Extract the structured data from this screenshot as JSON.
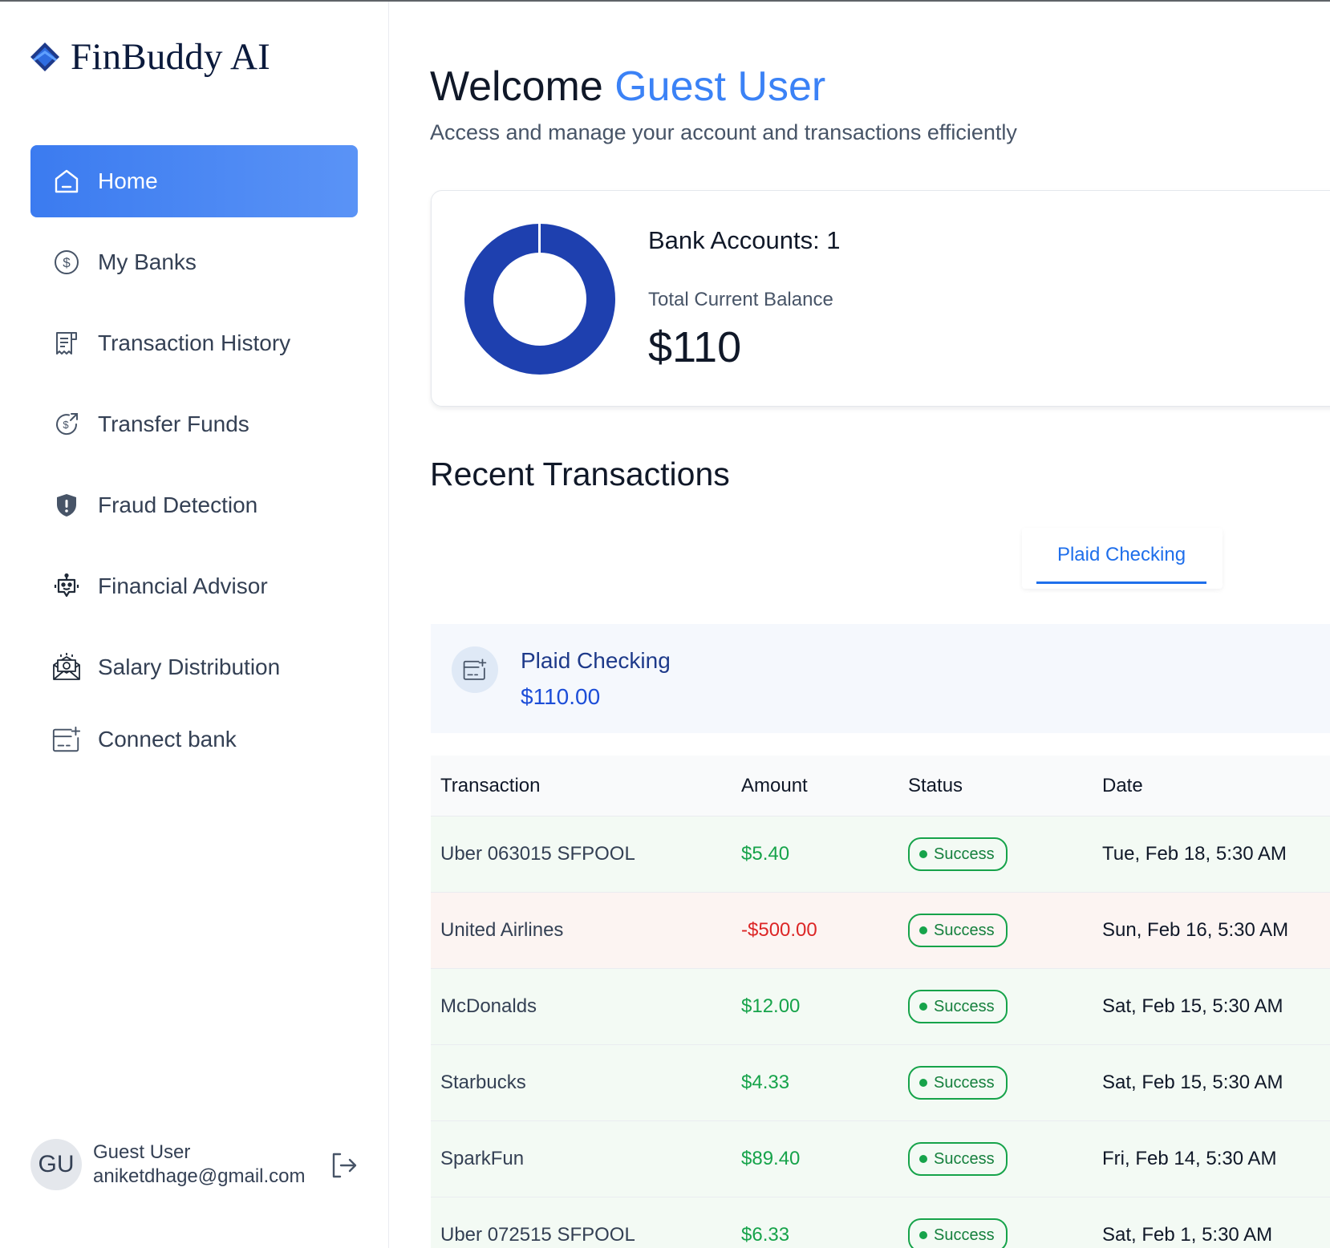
{
  "app": {
    "name": "FinBuddy AI"
  },
  "sidebar": {
    "items": [
      {
        "label": "Home",
        "icon": "home-icon",
        "active": true
      },
      {
        "label": "My Banks",
        "icon": "dollar-circle-icon"
      },
      {
        "label": "Transaction History",
        "icon": "receipt-icon"
      },
      {
        "label": "Transfer Funds",
        "icon": "money-send-icon"
      },
      {
        "label": "Fraud Detection",
        "icon": "shield-alert-icon"
      },
      {
        "label": "Financial Advisor",
        "icon": "robot-icon"
      },
      {
        "label": "Salary Distribution",
        "icon": "money-envelope-icon"
      },
      {
        "label": "Connect bank",
        "icon": "card-add-icon"
      }
    ],
    "user": {
      "initials": "GU",
      "name": "Guest User",
      "email": "aniketdhage@gmail.com"
    }
  },
  "header": {
    "welcome": "Welcome",
    "user_name": "Guest User",
    "subtitle": "Access and manage your account and transactions efficiently"
  },
  "balance": {
    "bank_accounts_label": "Bank Accounts: 1",
    "total_label": "Total Current Balance",
    "total_value": "$110",
    "donut_color": "#1e40af"
  },
  "recent": {
    "title": "Recent Transactions",
    "tabs": [
      {
        "label": "Plaid Checking",
        "active": true
      }
    ],
    "account": {
      "name": "Plaid Checking",
      "amount": "$110.00"
    },
    "columns": [
      "Transaction",
      "Amount",
      "Status",
      "Date"
    ],
    "rows": [
      {
        "name": "Uber 063015 SFPOOL",
        "amount": "$5.40",
        "type": "pos",
        "status": "Success",
        "date": "Tue, Feb 18, 5:30 AM"
      },
      {
        "name": "United Airlines",
        "amount": "-$500.00",
        "type": "neg",
        "status": "Success",
        "date": "Sun, Feb 16, 5:30 AM"
      },
      {
        "name": "McDonalds",
        "amount": "$12.00",
        "type": "pos",
        "status": "Success",
        "date": "Sat, Feb 15, 5:30 AM"
      },
      {
        "name": "Starbucks",
        "amount": "$4.33",
        "type": "pos",
        "status": "Success",
        "date": "Sat, Feb 15, 5:30 AM"
      },
      {
        "name": "SparkFun",
        "amount": "$89.40",
        "type": "pos",
        "status": "Success",
        "date": "Fri, Feb 14, 5:30 AM"
      },
      {
        "name": "Uber 072515 SFPOOL",
        "amount": "$6.33",
        "type": "pos",
        "status": "Success",
        "date": "Sat, Feb 1, 5:30 AM"
      }
    ]
  },
  "colors": {
    "accent": "#3b82f6",
    "positive": "#16a34a",
    "negative": "#dc2626"
  }
}
